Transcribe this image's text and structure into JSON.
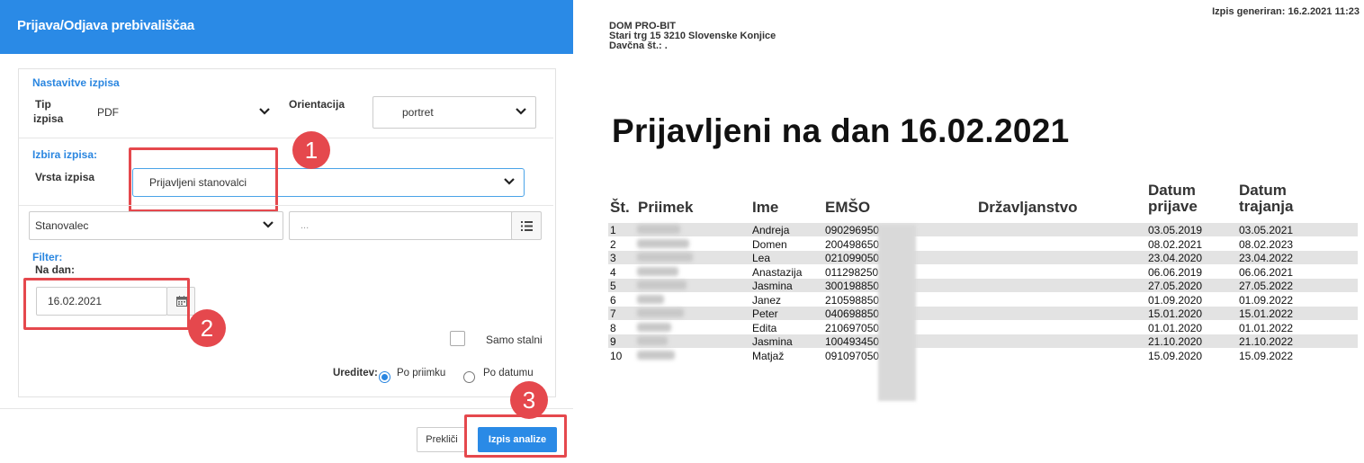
{
  "dialog": {
    "title": "Prijava/Odjava prebivališčaa",
    "output_settings": {
      "section_title": "Nastavitve izpisa",
      "type_label_line1": "Tip",
      "type_label_line2": "izpisa",
      "type_value": "PDF",
      "orientation_label": "Orientacija",
      "orientation_value": "portret"
    },
    "report_choice": {
      "section_title": "Izbira izpisa:",
      "kind_label": "Vrsta izpisa",
      "kind_value": "Prijavljeni stanovalci"
    },
    "resident": {
      "select_value": "Stanovalec",
      "input_placeholder": "..."
    },
    "filter": {
      "section_title": "Filter:",
      "on_day_label": "Na dan:",
      "date_value": "16.02.2021",
      "only_permanent_label": "Samo stalni",
      "sort_label": "Ureditev:",
      "sort_options": [
        "Po priimku",
        "Po datumu"
      ],
      "sort_selected": "Po priimku"
    },
    "buttons": {
      "cancel": "Prekliči",
      "run": "Izpis analize"
    },
    "badges": [
      "1",
      "2",
      "3"
    ]
  },
  "report": {
    "generated": "Izpis generiran: 16.2.2021 11:23",
    "company": "DOM PRO-BIT",
    "address": "Stari trg 15 3210 Slovenske Konjice",
    "tax": "Davčna št.: .",
    "title": "Prijavljeni na dan 16.02.2021",
    "columns": [
      "Št.",
      "Priimek",
      "Ime",
      "EMŠO",
      "Državljanstvo",
      "Datum prijave",
      "Datum trajanja"
    ],
    "rows": [
      {
        "no": "1",
        "name": "Andreja",
        "emso": "090296950",
        "from": "03.05.2019",
        "to": "03.05.2021"
      },
      {
        "no": "2",
        "name": "Domen",
        "emso": "200498650",
        "from": "08.02.2021",
        "to": "08.02.2023"
      },
      {
        "no": "3",
        "name": "Lea",
        "emso": "021099050",
        "from": "23.04.2020",
        "to": "23.04.2022"
      },
      {
        "no": "4",
        "name": "Anastazija",
        "emso": "011298250",
        "from": "06.06.2019",
        "to": "06.06.2021"
      },
      {
        "no": "5",
        "name": "Jasmina",
        "emso": "300198850",
        "from": "27.05.2020",
        "to": "27.05.2022"
      },
      {
        "no": "6",
        "name": "Janez",
        "emso": "210598850",
        "from": "01.09.2020",
        "to": "01.09.2022"
      },
      {
        "no": "7",
        "name": "Peter",
        "emso": "040698850",
        "from": "15.01.2020",
        "to": "15.01.2022"
      },
      {
        "no": "8",
        "name": "Edita",
        "emso": "210697050",
        "from": "01.01.2020",
        "to": "01.01.2022"
      },
      {
        "no": "9",
        "name": "Jasmina",
        "emso": "100493450",
        "from": "21.10.2020",
        "to": "21.10.2022"
      },
      {
        "no": "10",
        "name": "Matjaž",
        "emso": "091097050",
        "from": "15.09.2020",
        "to": "15.09.2022"
      }
    ]
  },
  "colors": {
    "header_blue": "#2a8ae6",
    "annotation_red": "#e5484d",
    "row_shade": "#e3e3e3"
  }
}
